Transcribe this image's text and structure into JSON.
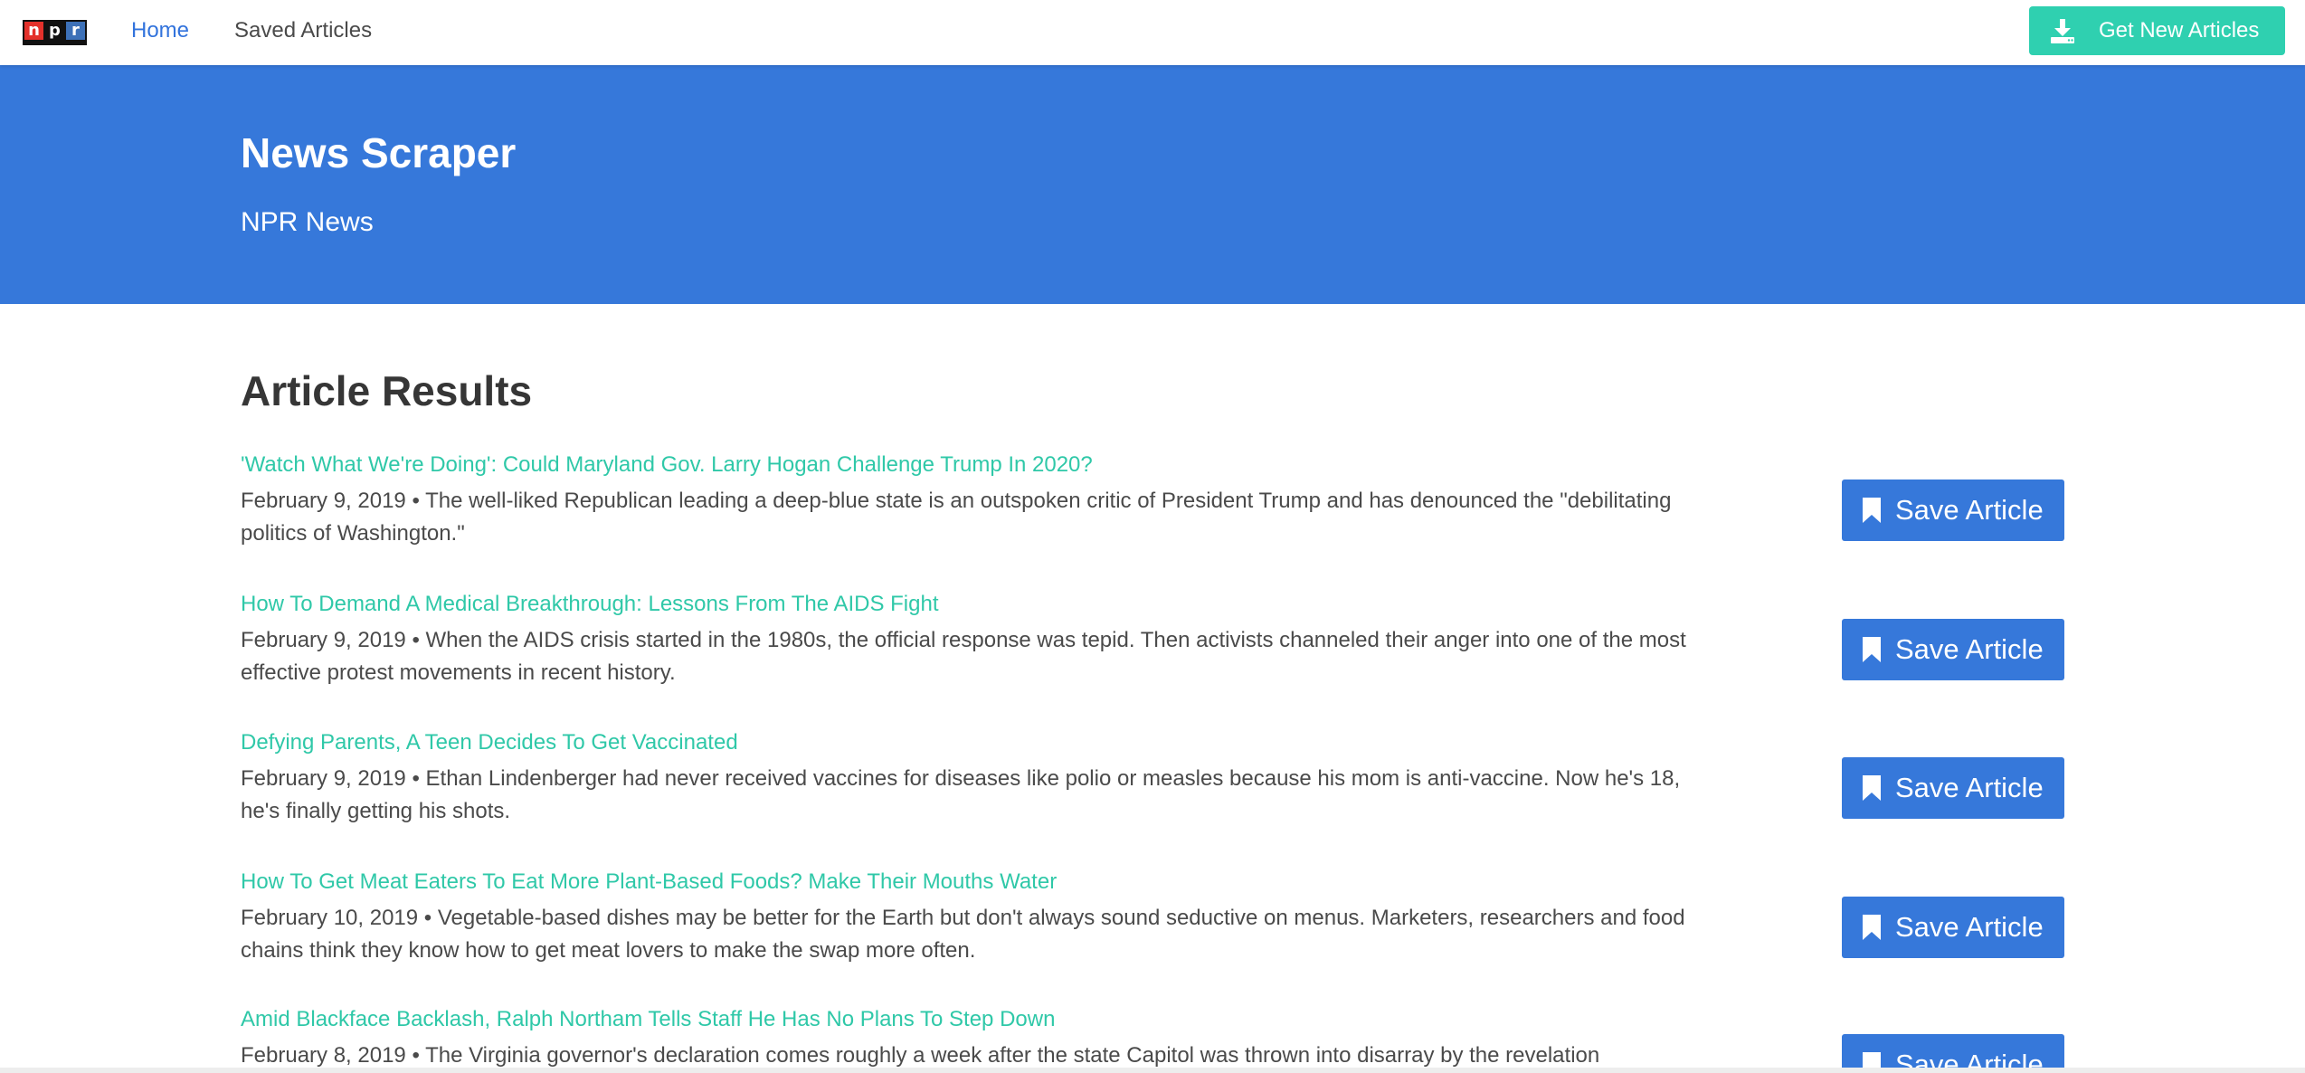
{
  "navbar": {
    "logo_letters": [
      "n",
      "p",
      "r"
    ],
    "home_label": "Home",
    "saved_label": "Saved Articles",
    "get_new_label": "Get New Articles",
    "get_new_icon": "download-icon",
    "get_new_color": "#2fd0b0",
    "active_link_color": "#3273dc"
  },
  "hero": {
    "title": "News Scraper",
    "subtitle": "NPR News",
    "background_color": "#3678da"
  },
  "main": {
    "heading": "Article Results",
    "save_label": "Save Article",
    "save_icon": "bookmark-icon",
    "title_link_color": "#2fc8a8",
    "articles": [
      {
        "title": "'Watch What We're Doing': Could Maryland Gov. Larry Hogan Challenge Trump In 2020?",
        "summary": "February 9, 2019 • The well-liked Republican leading a deep-blue state is an outspoken critic of President Trump and has denounced the \"debilitating politics of Washington.\""
      },
      {
        "title": "How To Demand A Medical Breakthrough: Lessons From The AIDS Fight",
        "summary": "February 9, 2019 • When the AIDS crisis started in the 1980s, the official response was tepid. Then activists channeled their anger into one of the most effective protest movements in recent history."
      },
      {
        "title": "Defying Parents, A Teen Decides To Get Vaccinated",
        "summary": "February 9, 2019 • Ethan Lindenberger had never received vaccines for diseases like polio or measles because his mom is anti-vaccine. Now he's 18, he's finally getting his shots."
      },
      {
        "title": "How To Get Meat Eaters To Eat More Plant-Based Foods? Make Their Mouths Water",
        "summary": "February 10, 2019 • Vegetable-based dishes may be better for the Earth but don't always sound seductive on menus. Marketers, researchers and food chains think they know how to get meat lovers to make the swap more often."
      },
      {
        "title": "Amid Blackface Backlash, Ralph Northam Tells Staff He Has No Plans To Step Down",
        "summary": "February 8, 2019 • The Virginia governor's declaration comes roughly a week after the state Capitol was thrown into disarray by the revelation"
      }
    ]
  }
}
